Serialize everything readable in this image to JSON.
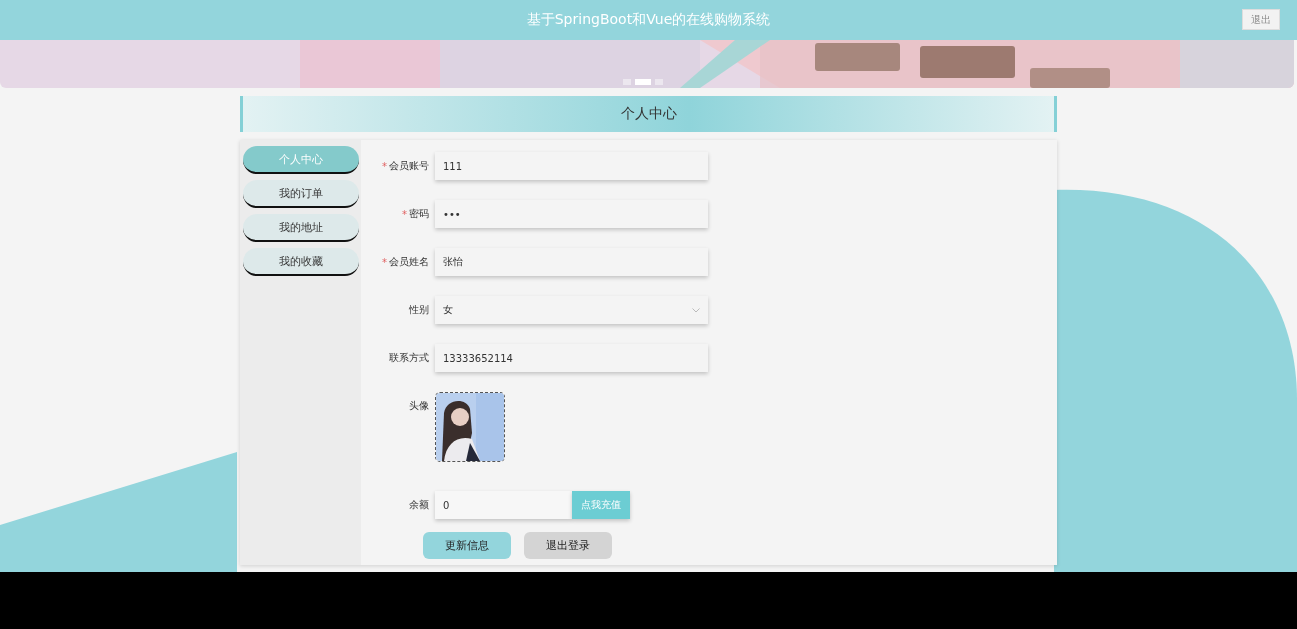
{
  "header": {
    "title": "基于SpringBoot和Vue的在线购物系统",
    "logout": "退出"
  },
  "banner": {
    "dots": [
      {
        "selected": false
      },
      {
        "selected": true
      },
      {
        "selected": false
      }
    ]
  },
  "section_title": "个人中心",
  "sidebar": {
    "items": [
      {
        "label": "个人中心",
        "selected": true
      },
      {
        "label": "我的订单",
        "selected": false
      },
      {
        "label": "我的地址",
        "selected": false
      },
      {
        "label": "我的收藏",
        "selected": false
      }
    ]
  },
  "form": {
    "fields": [
      {
        "kind": "text",
        "label": "会员账号",
        "marker": "*",
        "value": "111"
      },
      {
        "kind": "text",
        "label": "密码",
        "marker": "*",
        "value": "•••"
      },
      {
        "kind": "text",
        "label": "会员姓名",
        "marker": "*",
        "value": "张怡"
      },
      {
        "kind": "select",
        "label": "性别",
        "value": "女"
      },
      {
        "kind": "text",
        "label": "联系方式",
        "value": "13333652114"
      },
      {
        "label": "头像"
      },
      {
        "kind": "balance",
        "label": "余额",
        "value": "0",
        "action": "点我充值"
      }
    ],
    "buttons": [
      {
        "label": "更新信息",
        "kind": "primary"
      },
      {
        "label": "退出登录",
        "kind": "secondary"
      }
    ]
  }
}
